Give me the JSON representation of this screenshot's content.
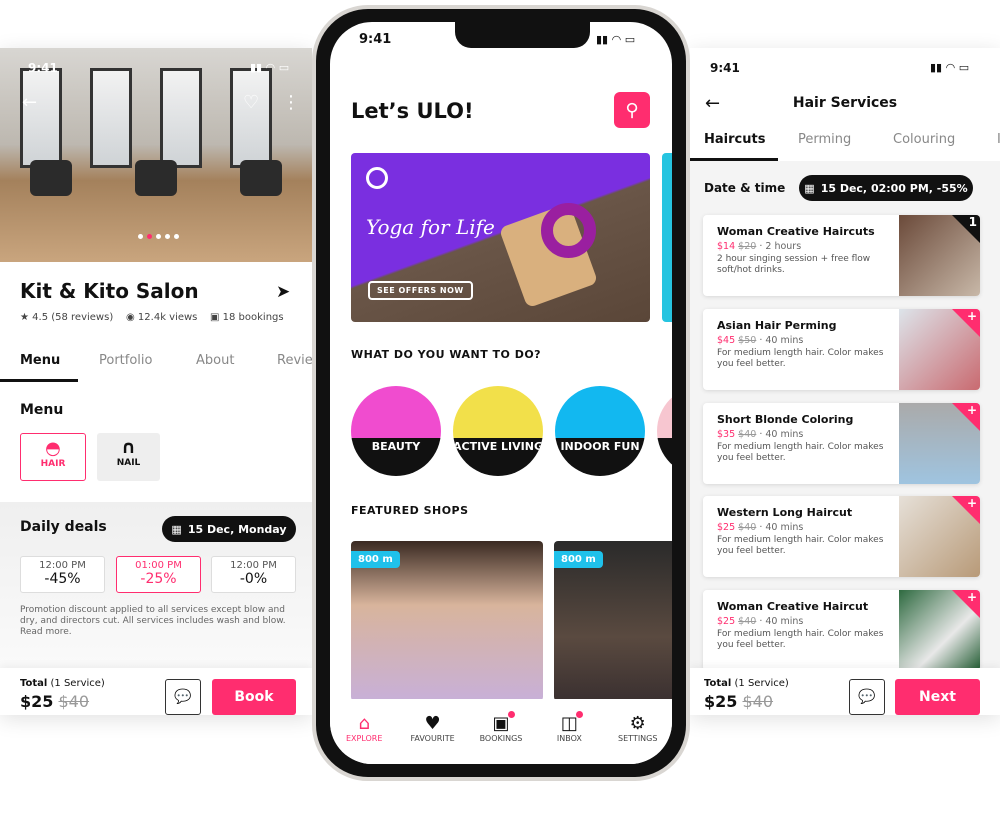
{
  "colors": {
    "accent": "#ff2d6f",
    "distance_badge": "#1fc1ea",
    "banner": "#7a2fe0"
  },
  "left": {
    "status_time": "9:41",
    "salon_name": "Kit & Kito Salon",
    "rating": "4.5 (58 reviews)",
    "views": "12.4k views",
    "bookings": "18 bookings",
    "tabs": [
      "Menu",
      "Portfolio",
      "About",
      "Revie"
    ],
    "menu_title": "Menu",
    "categories": [
      {
        "label": "HAIR",
        "icon": "hair-icon"
      },
      {
        "label": "NAIL",
        "icon": "nail-icon"
      }
    ],
    "deals_title": "Daily deals",
    "deals_date": "15 Dec, Monday",
    "deals": [
      {
        "time": "12:00 PM",
        "discount": "-45%"
      },
      {
        "time": "01:00 PM",
        "discount": "-25%"
      },
      {
        "time": "12:00 PM",
        "discount": "-0%"
      }
    ],
    "promo": "Promotion discount applied to all services except blow and dry, and directors cut. All services includes wash and blow. Read more.",
    "total_label": "Total",
    "total_count": "(1 Service)",
    "price": "$25",
    "old_price": "$40",
    "book": "Book"
  },
  "center": {
    "status_time": "9:41",
    "title": "Let’s ULO!",
    "banner_title": "Yoga for Life",
    "banner_cta": "SEE OFFERS NOW",
    "what_title": "WHAT DO YOU WANT TO DO?",
    "activities": [
      "BEAUTY",
      "ACTIVE LIVING",
      "INDOOR FUN",
      "E"
    ],
    "featured_title": "FEATURED SHOPS",
    "shops": [
      {
        "distance": "800 m"
      },
      {
        "distance": "800 m"
      }
    ],
    "nav": [
      {
        "label": "EXPLORE",
        "icon": "home-icon"
      },
      {
        "label": "FAVOURITE",
        "icon": "heart-icon"
      },
      {
        "label": "BOOKINGS",
        "icon": "camera-icon"
      },
      {
        "label": "INBOX",
        "icon": "inbox-icon"
      },
      {
        "label": "SETTINGS",
        "icon": "gear-icon"
      }
    ]
  },
  "right": {
    "status_time": "9:41",
    "title": "Hair Services",
    "tabs": [
      "Haircuts",
      "Perming",
      "Colouring",
      "I"
    ],
    "date_label": "Date & time",
    "date_value": "15 Dec, 02:00 PM, -55%",
    "services": [
      {
        "name": "Woman Creative Haircuts",
        "price": "$14",
        "old": "$20",
        "duration": "2 hours",
        "desc": "2 hour singing session + free flow soft/hot drinks.",
        "badge": "1"
      },
      {
        "name": "Asian Hair Perming",
        "price": "$45",
        "old": "$50",
        "duration": "40 mins",
        "desc": "For medium length hair. Color makes you feel better.",
        "badge": "+"
      },
      {
        "name": "Short Blonde Coloring",
        "price": "$35",
        "old": "$40",
        "duration": "40 mins",
        "desc": "For medium length hair. Color makes you feel better.",
        "badge": "+"
      },
      {
        "name": "Western Long Haircut",
        "price": "$25",
        "old": "$40",
        "duration": "40 mins",
        "desc": "For medium length hair. Color makes you feel better.",
        "badge": "+"
      },
      {
        "name": "Woman Creative Haircut",
        "price": "$25",
        "old": "$40",
        "duration": "40 mins",
        "desc": "For medium length hair. Color makes you feel better.",
        "badge": "+"
      }
    ],
    "total_label": "Total",
    "total_count": "(1 Service)",
    "price": "$25",
    "old_price": "$40",
    "next": "Next"
  }
}
